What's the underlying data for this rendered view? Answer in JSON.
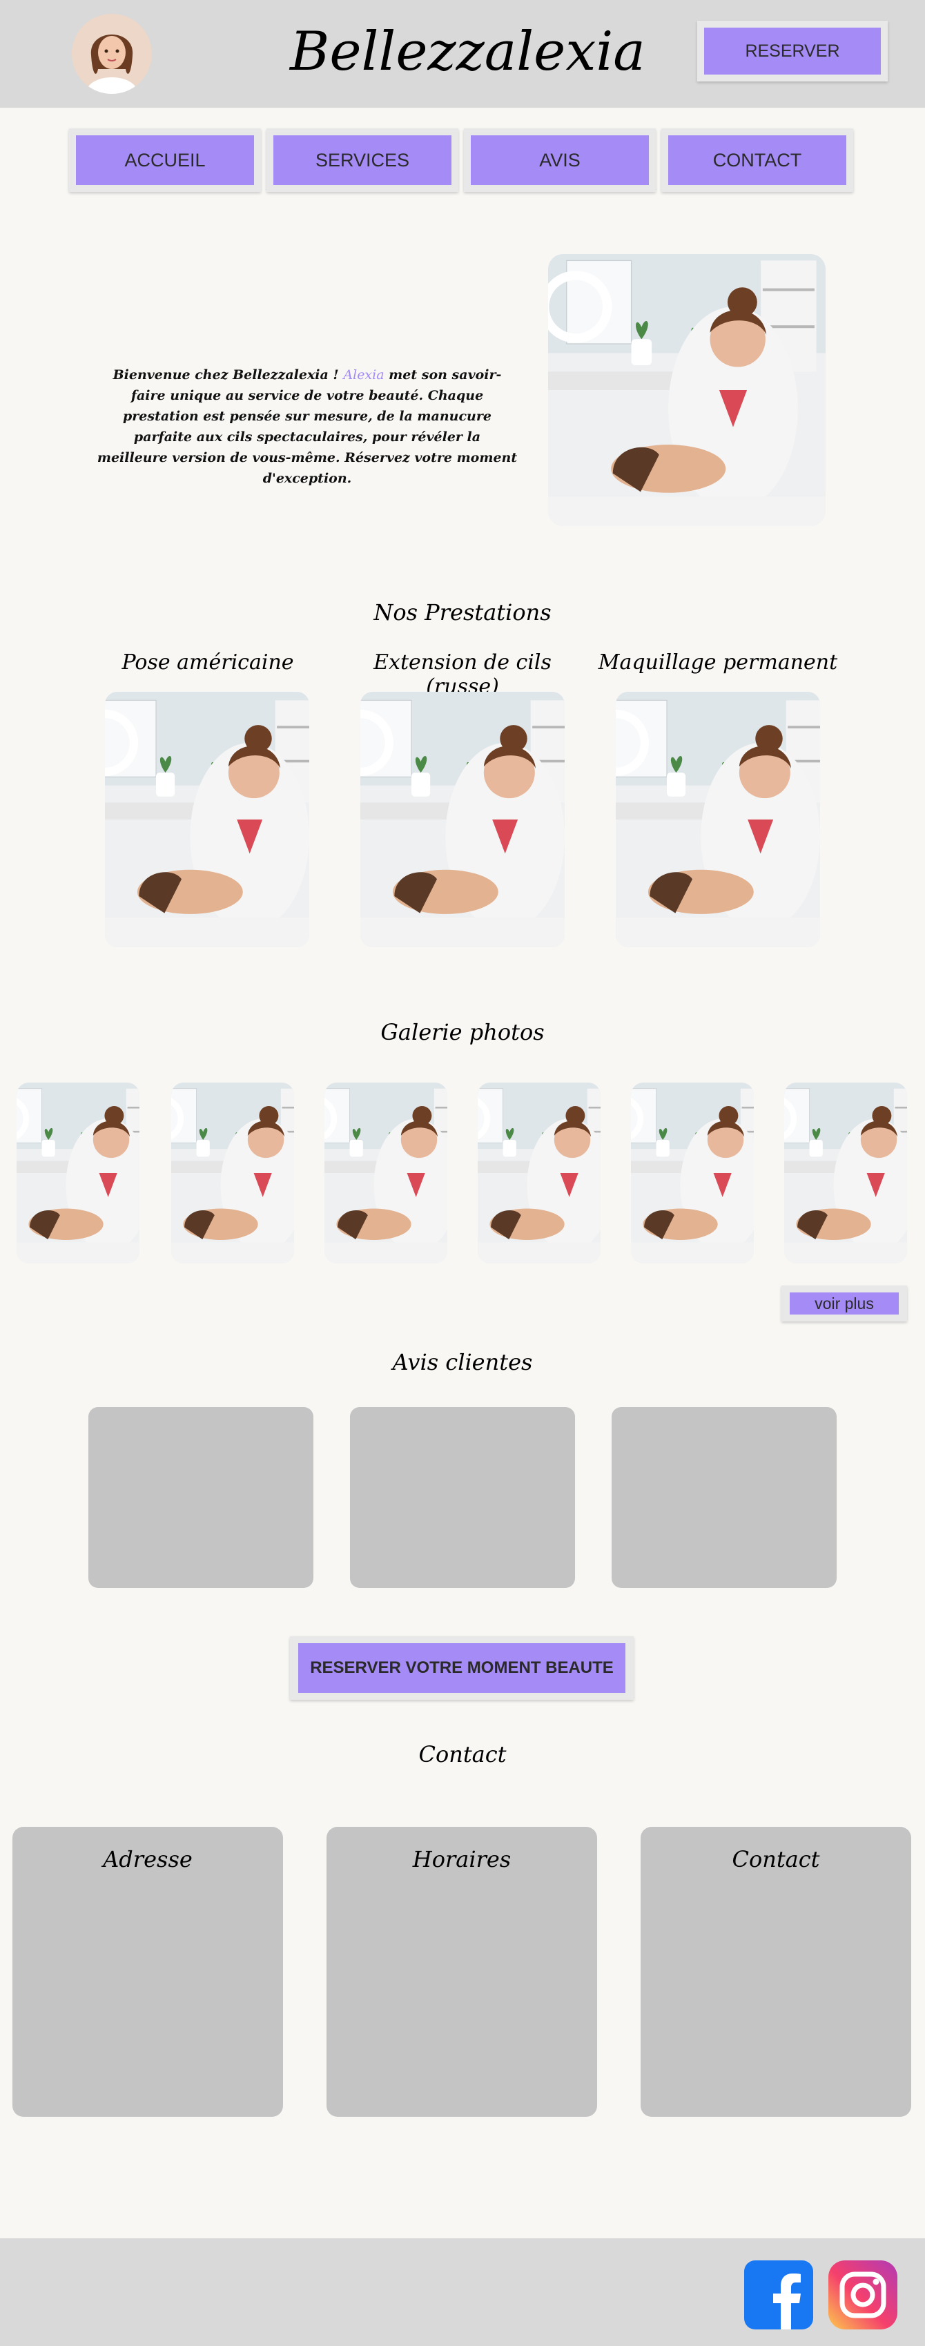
{
  "header": {
    "brand": "Bellezzalexia",
    "reserve_label": "RESERVER"
  },
  "nav": {
    "items": [
      {
        "label": "ACCUEIL"
      },
      {
        "label": "SERVICES"
      },
      {
        "label": "AVIS"
      },
      {
        "label": "CONTACT"
      }
    ]
  },
  "intro": {
    "text_before": "Bienvenue chez Bellezzalexia ! ",
    "accent": "Alexia",
    "text_after": " met son savoir-faire unique au service de votre beauté. Chaque prestation est pensée sur mesure, de la manucure parfaite aux cils spectaculaires, pour révéler la meilleure version de vous-même. Réservez votre moment d'exception."
  },
  "services": {
    "title": "Nos Prestations",
    "items": [
      {
        "name": "Pose américaine"
      },
      {
        "name": "Extension de cils (russe)"
      },
      {
        "name": "Maquillage permanent"
      }
    ]
  },
  "gallery": {
    "title": "Galerie photos",
    "more_label": "voir plus"
  },
  "reviews": {
    "title": "Avis clientes"
  },
  "cta": {
    "label": "RESERVER VOTRE MOMENT BEAUTE"
  },
  "contact": {
    "title": "Contact",
    "cards": [
      {
        "title": "Adresse"
      },
      {
        "title": "Horaires"
      },
      {
        "title": "Contact"
      }
    ]
  },
  "footer": {
    "icons": [
      "facebook-icon",
      "instagram-icon"
    ]
  },
  "colors": {
    "accent": "#a48bf5",
    "header_bg": "#d9d9d9",
    "page_bg": "#f8f7f4",
    "card_bg": "#c4c4c4",
    "facebook": "#1877f2"
  }
}
